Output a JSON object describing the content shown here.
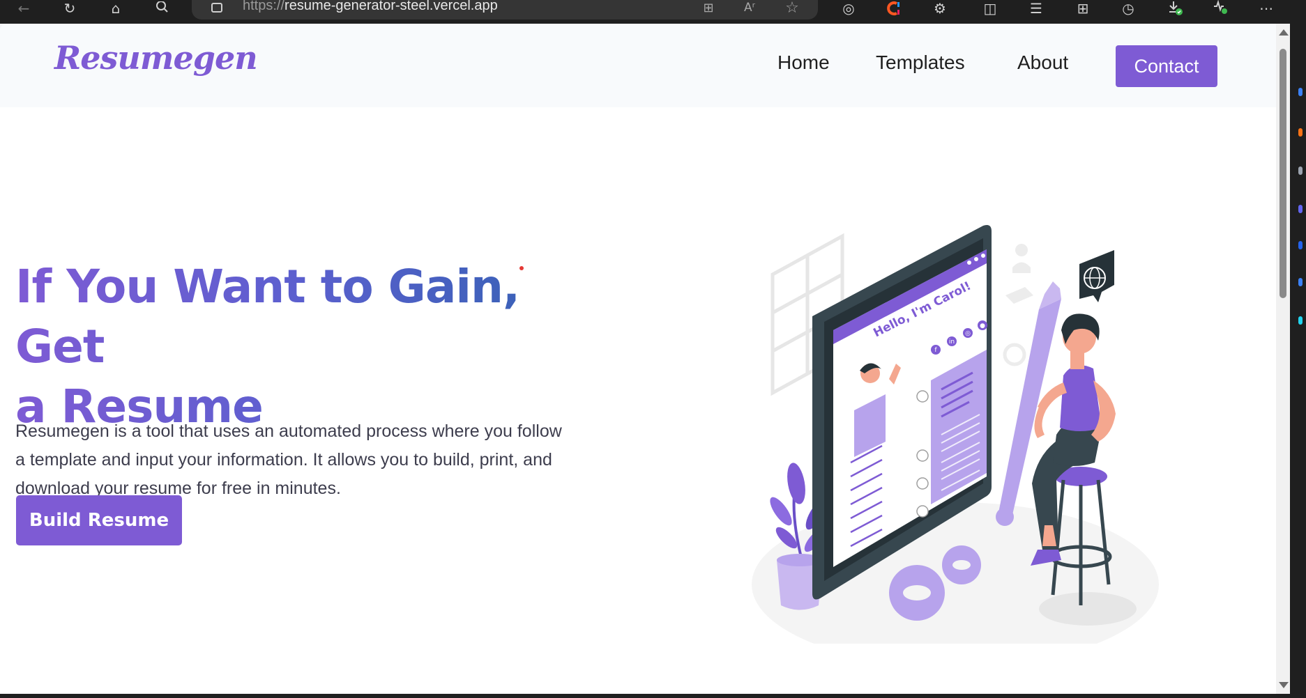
{
  "browser": {
    "url_scheme": "https://",
    "url_host": "resume-generator-steel.vercel.app",
    "toolbar_icons": [
      "back-icon",
      "refresh-icon",
      "home-icon",
      "search-icon",
      "site-info-icon",
      "app-available-icon",
      "read-aloud-icon",
      "favorite-star-icon",
      "tracking-icon",
      "extension-c-icon",
      "extensions-icon",
      "split-screen-icon",
      "favorites-icon",
      "collections-icon",
      "history-icon",
      "downloads-icon",
      "performance-icon",
      "more-menu-icon"
    ],
    "read_aloud_glyph": "Aʳ"
  },
  "site": {
    "logo": "Resumegen",
    "nav": {
      "home": "Home",
      "templates": "Templates",
      "about": "About",
      "contact": "Contact"
    }
  },
  "hero": {
    "title_line1": "If You Want to Gain, Get",
    "title_line2": "a Resume",
    "description_line1": "Resumegen is a tool that uses an automated process where you follow",
    "description_line2": "a template and input your information. It allows you to build, print, and",
    "description_line3": "download your resume for free in minutes.",
    "cta": "Build Resume"
  },
  "illustration": {
    "greeting": "Hello, I'm Carol!",
    "social_icons": [
      "f",
      "in",
      "◎",
      "●"
    ]
  },
  "colors": {
    "brand": "#7e5bd4",
    "brand_light": "#b7a3ec",
    "title_gradient_end": "#2f62b0",
    "dark_device": "#37474f"
  }
}
